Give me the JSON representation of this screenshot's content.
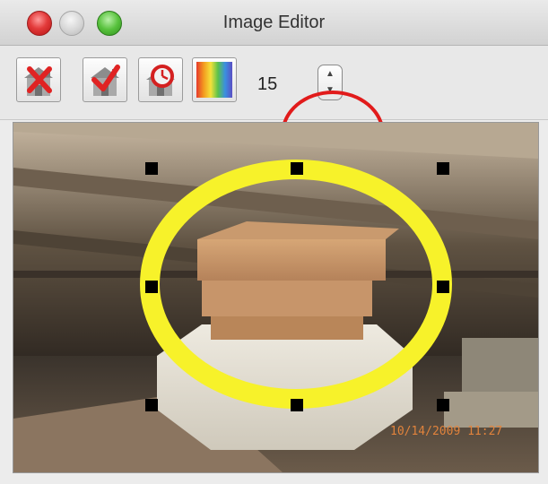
{
  "window": {
    "title": "Image Editor"
  },
  "toolbar": {
    "buttons": [
      {
        "name": "delete-button",
        "icon": "delete-x-icon"
      },
      {
        "name": "accept-button",
        "icon": "checkmark-icon"
      },
      {
        "name": "clock-button",
        "icon": "clock-icon"
      },
      {
        "name": "color-palette-button",
        "icon": "spectrum-icon"
      }
    ],
    "count_value": "15",
    "stepper": {
      "up_symbol": "▲",
      "down_symbol": "▼"
    }
  },
  "canvas": {
    "timestamp": "10/14/2009 11:27",
    "selection": {
      "shape": "ellipse",
      "stroke_color": "#f7f22a"
    }
  },
  "colors": {
    "annotation": "#e11b1b",
    "selection": "#f7f22a"
  }
}
